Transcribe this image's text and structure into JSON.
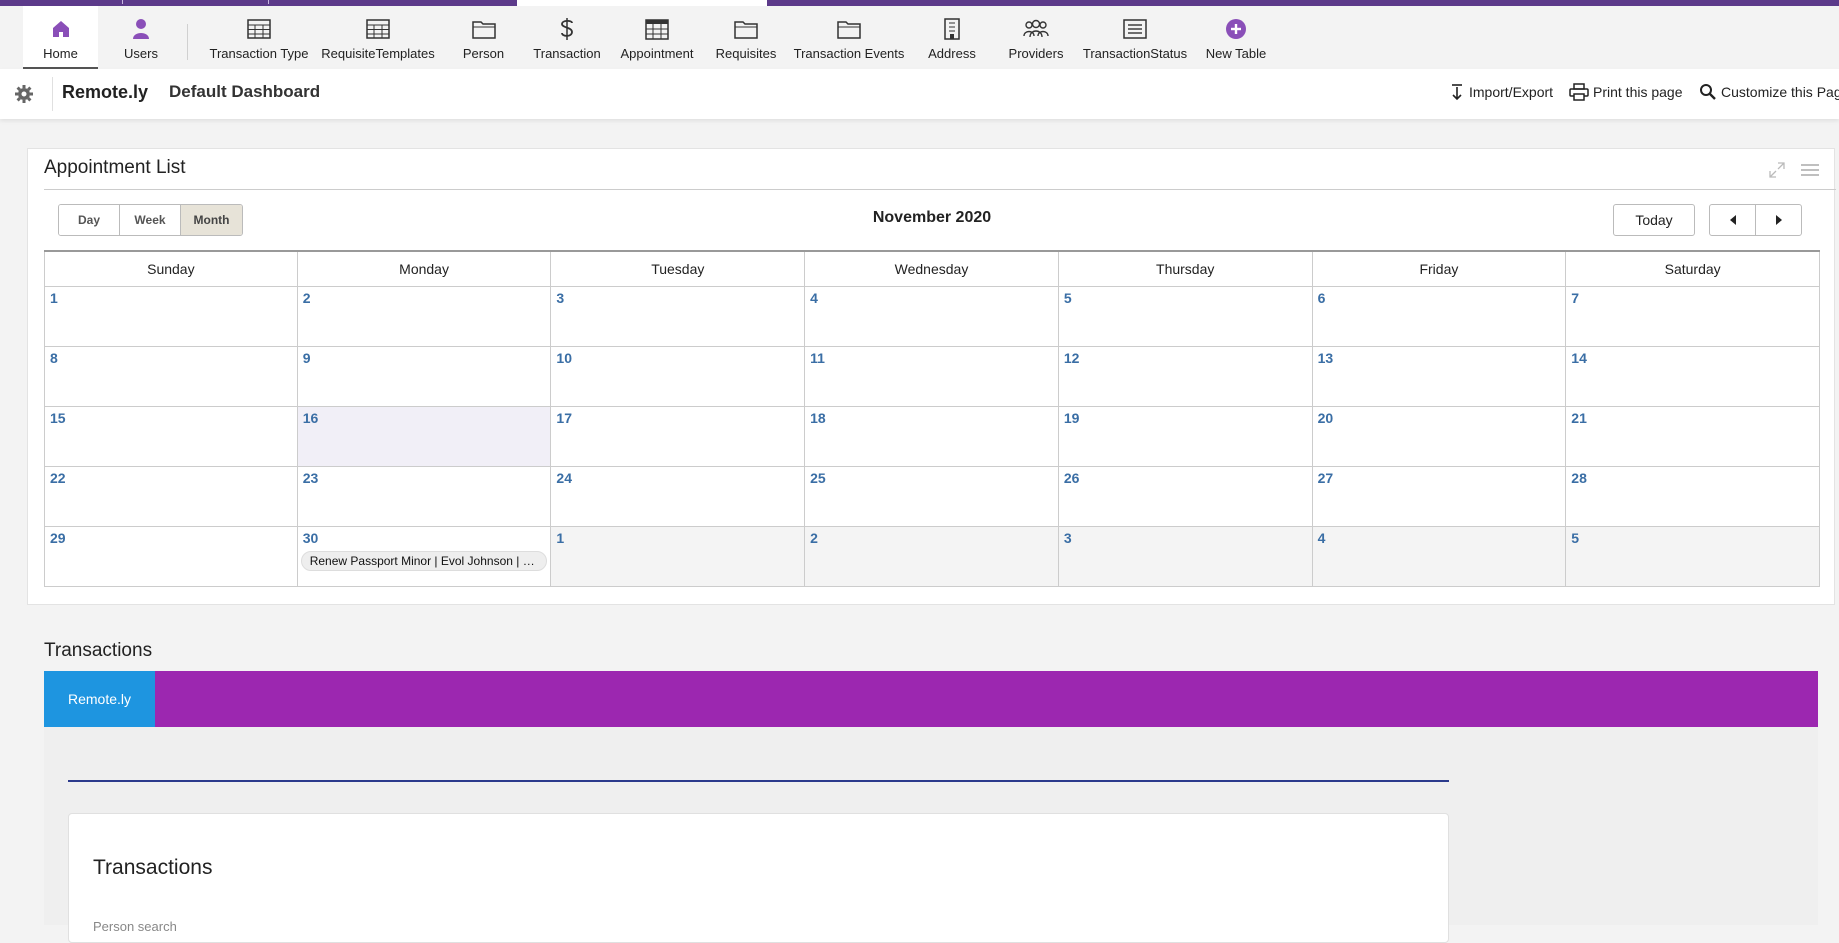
{
  "toolbar": {
    "items": [
      {
        "label": "Home",
        "icon": "home-icon"
      },
      {
        "label": "Users",
        "icon": "user-icon"
      },
      {
        "label": "Transaction Type",
        "icon": "table-icon"
      },
      {
        "label": "RequisiteTemplates",
        "icon": "table-icon"
      },
      {
        "label": "Person",
        "icon": "folder-icon"
      },
      {
        "label": "Transaction",
        "icon": "dollar-icon"
      },
      {
        "label": "Appointment",
        "icon": "calendar-grid-icon"
      },
      {
        "label": "Requisites",
        "icon": "folder-icon"
      },
      {
        "label": "Transaction Events",
        "icon": "folder-icon"
      },
      {
        "label": "Address",
        "icon": "building-icon"
      },
      {
        "label": "Providers",
        "icon": "group-icon"
      },
      {
        "label": "TransactionStatus",
        "icon": "list-icon"
      },
      {
        "label": "New Table",
        "icon": "plus-circle-icon"
      }
    ],
    "accent": "#8a4fb8"
  },
  "header": {
    "brand": "Remote.ly",
    "dashboard": "Default Dashboard",
    "import_export": "Import/Export",
    "print": "Print this page",
    "customize": "Customize this Page"
  },
  "appointment": {
    "title": "Appointment List",
    "views": [
      "Day",
      "Week",
      "Month"
    ],
    "selected_view": "Month",
    "month_title": "November 2020",
    "today_label": "Today",
    "weekdays": [
      "Sunday",
      "Monday",
      "Tuesday",
      "Wednesday",
      "Thursday",
      "Friday",
      "Saturday"
    ],
    "weeks": [
      [
        "1",
        "2",
        "3",
        "4",
        "5",
        "6",
        "7"
      ],
      [
        "8",
        "9",
        "10",
        "11",
        "12",
        "13",
        "14"
      ],
      [
        "15",
        "16",
        "17",
        "18",
        "19",
        "20",
        "21"
      ],
      [
        "22",
        "23",
        "24",
        "25",
        "26",
        "27",
        "28"
      ],
      [
        "29",
        "30",
        "1",
        "2",
        "3",
        "4",
        "5"
      ]
    ],
    "today_date": "16",
    "event": {
      "label": "Renew Passport Minor | Evol Johnson | d...",
      "date": "30"
    }
  },
  "transactions": {
    "title": "Transactions",
    "tab": "Remote.ly",
    "card_title": "Transactions",
    "card_sub": "Person search",
    "bar_color": "#9c27b0",
    "tab_color": "#1e95e0"
  }
}
